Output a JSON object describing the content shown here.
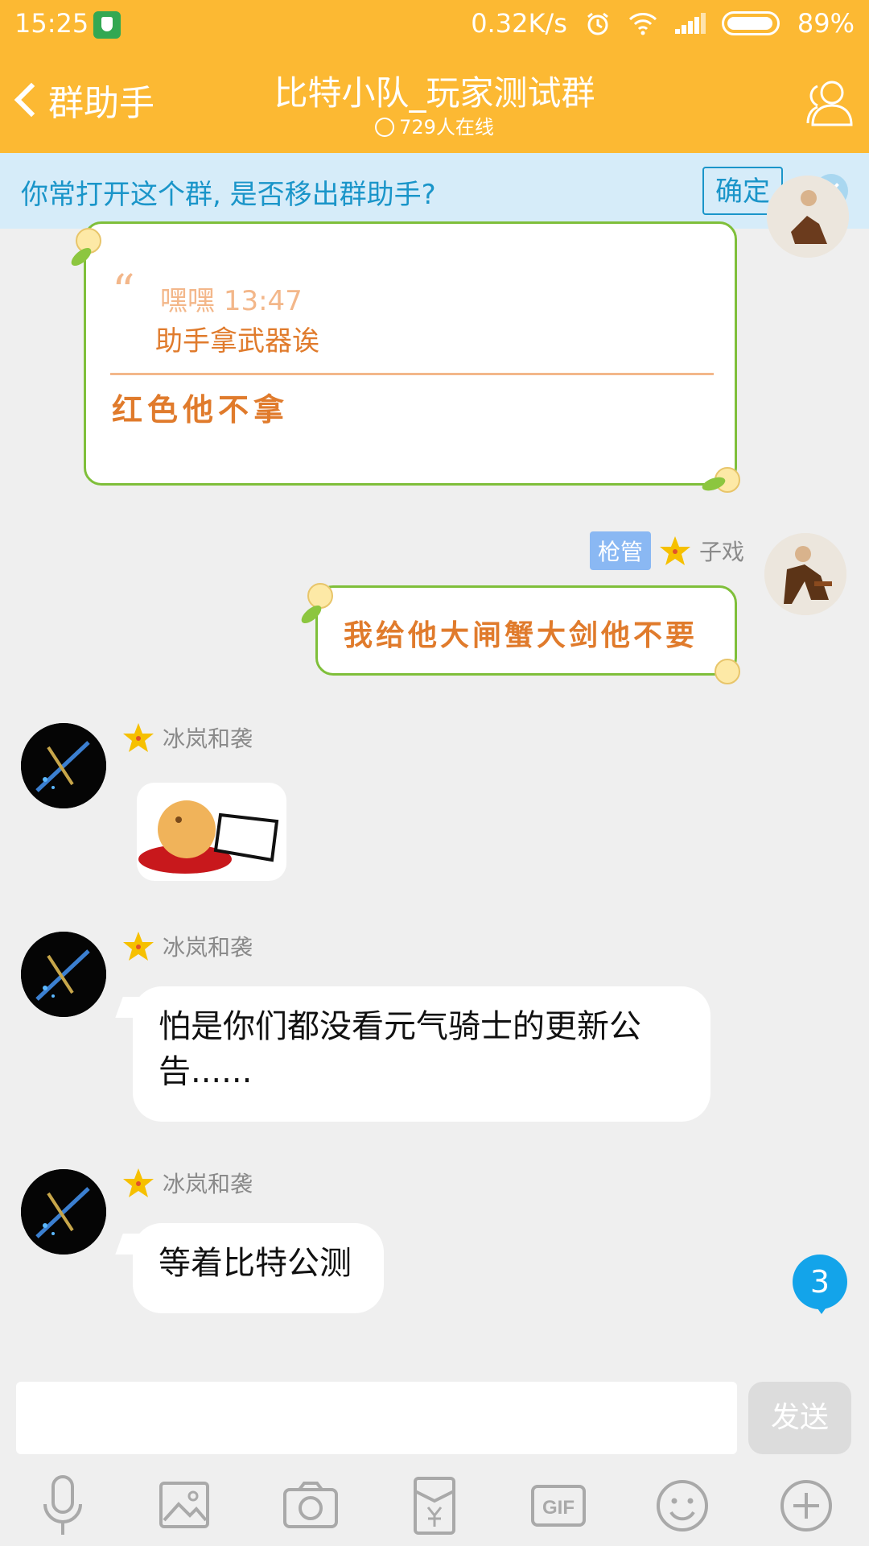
{
  "status_bar": {
    "time": "15:25",
    "network_speed": "0.32K/s",
    "battery": "89%"
  },
  "header": {
    "back_label": "群助手",
    "title": "比特小队_玩家测试群",
    "online": "729人在线"
  },
  "banner": {
    "text": "你常打开这个群, 是否移出群助手?",
    "confirm_label": "确定"
  },
  "messages": [
    {
      "quote_author": "嘿嘿",
      "quote_time": "13:47",
      "quote_text": "助手拿武器诶",
      "reply_text": "红色他不拿"
    },
    {
      "sender_role": "枪管",
      "sender": "子戏",
      "text": "我给他大闸蟹大剑他不要"
    },
    {
      "sender": "冰岚和袭",
      "type": "sticker"
    },
    {
      "sender": "冰岚和袭",
      "text": "怕是你们都没看元气骑士的更新公告......"
    },
    {
      "sender": "冰岚和袭",
      "text": "等着比特公测"
    }
  ],
  "unread_count": "3",
  "composer": {
    "send_label": "发送"
  },
  "toolbar_icons": [
    "mic-icon",
    "image-icon",
    "camera-icon",
    "red-packet-icon",
    "gif-icon",
    "emoji-icon",
    "plus-icon"
  ],
  "colors": {
    "header_bg": "#fcb933",
    "banner_bg": "#d6ecf9",
    "accent_blue": "#1a95c9",
    "deco_text": "#e07b2c",
    "deco_border": "#7fbf3a"
  }
}
